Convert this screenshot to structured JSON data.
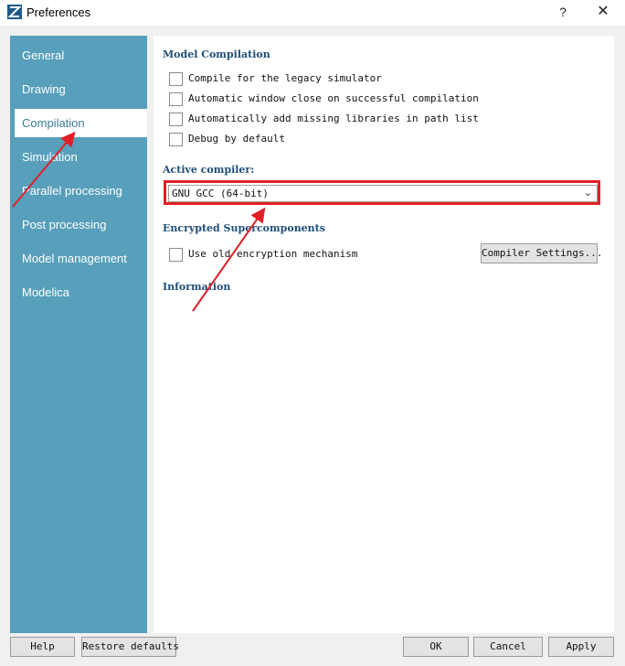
{
  "window": {
    "title": "Preferences",
    "help_glyph": "?",
    "close_glyph": "✕"
  },
  "sidebar": {
    "items": [
      {
        "label": "General",
        "active": false
      },
      {
        "label": "Drawing",
        "active": false
      },
      {
        "label": "Compilation",
        "active": true
      },
      {
        "label": "Simulation",
        "active": false
      },
      {
        "label": "Parallel processing",
        "active": false
      },
      {
        "label": "Post processing",
        "active": false
      },
      {
        "label": "Model management",
        "active": false
      },
      {
        "label": "Modelica",
        "active": false
      }
    ]
  },
  "main": {
    "model_compilation_title": "Model Compilation",
    "options": [
      {
        "label": "Compile for the legacy simulator",
        "checked": false
      },
      {
        "label": "Automatic window close on successful compilation",
        "checked": false
      },
      {
        "label": "Automatically add missing libraries in path list",
        "checked": false
      },
      {
        "label": "Debug by default",
        "checked": false
      }
    ],
    "active_compiler_label": "Active compiler:",
    "active_compiler_value": "GNU GCC (64-bit)",
    "encrypted_title": "Encrypted Supercomponents",
    "encryption_option": {
      "label": "Use old encryption mechanism",
      "checked": false
    },
    "compiler_settings_label": "Compiler Settings...",
    "information_title": "Information"
  },
  "footer": {
    "help": "Help",
    "restore_defaults": "Restore defaults",
    "ok": "OK",
    "cancel": "Cancel",
    "apply": "Apply"
  },
  "colors": {
    "sidebar": "#579fba",
    "highlight": "#e02026",
    "section_title": "#1f4e79"
  },
  "icons": {
    "app": "app-logo-icon",
    "dropdown": "chevron-down-icon"
  }
}
